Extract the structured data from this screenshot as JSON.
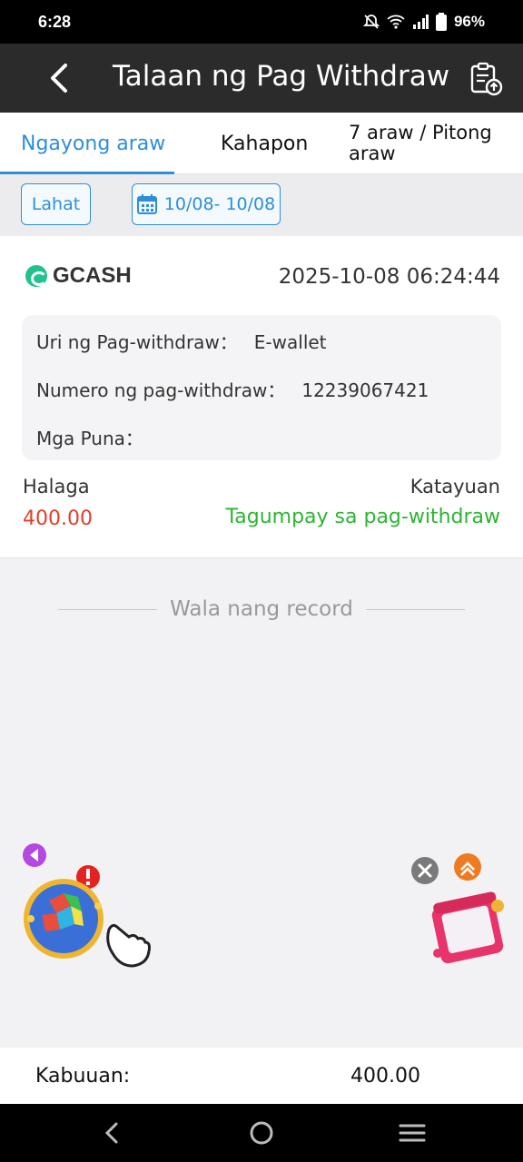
{
  "status_bar": {
    "time": "6:28",
    "battery": "96%",
    "icons": [
      "do-not-disturb-icon",
      "wifi-icon",
      "signal-icon",
      "battery-icon"
    ]
  },
  "header": {
    "title": "Talaan ng Pag Withdraw",
    "back_icon": "chevron-left-icon",
    "action_icon": "document-upload-icon"
  },
  "tabs": [
    {
      "label": "Ngayong araw",
      "active": true
    },
    {
      "label": "Kahapon",
      "active": false
    },
    {
      "label": "7 araw / Pitong araw",
      "active": false
    }
  ],
  "filters": {
    "all_label": "Lahat",
    "date_range": "10/08- 10/08",
    "date_icon": "calendar-icon"
  },
  "record": {
    "provider": "GCASH",
    "datetime": "2025-10-08 06:24:44",
    "type_label": "Uri ng Pag-withdraw：",
    "type_value": "E-wallet",
    "number_label": "Numero ng pag-withdraw：",
    "number_value": "12239067421",
    "remarks_label": "Mga Puna：",
    "remarks_value": "",
    "amount_label": "Halaga",
    "amount_value": "400.00",
    "status_label": "Katayuan",
    "status_value": "Tagumpay sa pag-withdraw"
  },
  "list_end": "Wala nang record",
  "footer": {
    "total_label": "Kabuuan:",
    "total_value": "400.00"
  },
  "colors": {
    "accent": "#2e8fd6",
    "amount": "#e0402a",
    "success": "#2db532",
    "header_bg": "#2b2b2b"
  }
}
